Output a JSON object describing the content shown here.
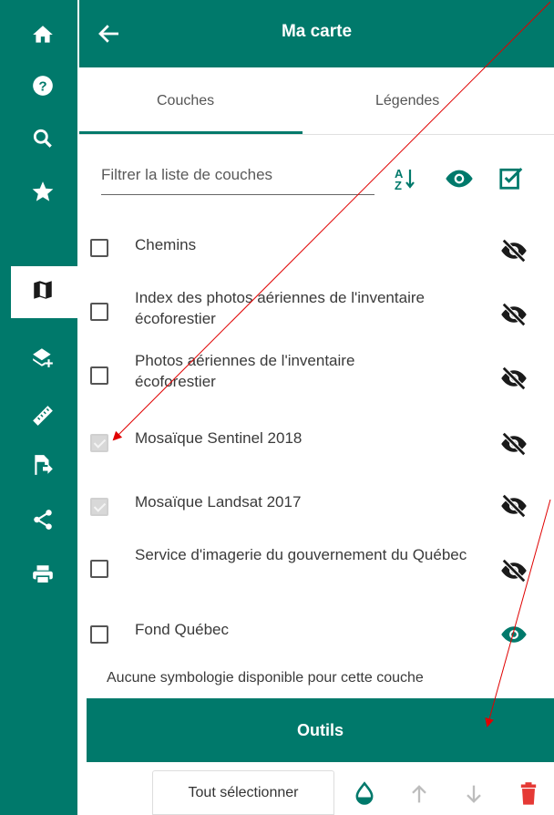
{
  "sidebar": {
    "items": [
      {
        "name": "home-icon"
      },
      {
        "name": "help-icon"
      },
      {
        "name": "search-icon"
      },
      {
        "name": "star-icon"
      },
      {
        "name": "map-icon",
        "active": true
      },
      {
        "name": "add-layer-icon"
      },
      {
        "name": "ruler-icon"
      },
      {
        "name": "export-file-icon"
      },
      {
        "name": "share-icon"
      },
      {
        "name": "print-icon"
      }
    ]
  },
  "header": {
    "title": "Ma carte"
  },
  "tabs": [
    {
      "label": "Couches",
      "active": true
    },
    {
      "label": "Légendes",
      "active": false
    }
  ],
  "filter": {
    "placeholder": "Filtrer la liste de couches",
    "value": ""
  },
  "layers": [
    {
      "label": "Chemins",
      "checked": false,
      "visible": false
    },
    {
      "label": "Index des photos aériennes de l'inventaire écoforestier",
      "checked": false,
      "visible": false
    },
    {
      "label": "Photos aériennes de l'inventaire écoforestier",
      "checked": false,
      "visible": false
    },
    {
      "label": "Mosaïque Sentinel 2018",
      "checked": true,
      "visible": false
    },
    {
      "label": "Mosaïque Landsat 2017",
      "checked": true,
      "visible": false
    },
    {
      "label": "Service d'imagerie du gouvernement du Québec",
      "checked": false,
      "visible": false
    },
    {
      "label": "Fond Québec",
      "checked": false,
      "visible": true
    }
  ],
  "note": "Aucune symbologie disponible pour cette couche",
  "outils": {
    "label": "Outils"
  },
  "bottom_toolbar": {
    "select_all_label": "Tout sélectionner"
  },
  "colors": {
    "primary": "#00796b",
    "delete": "#e53935",
    "annotation": "#e00000"
  }
}
